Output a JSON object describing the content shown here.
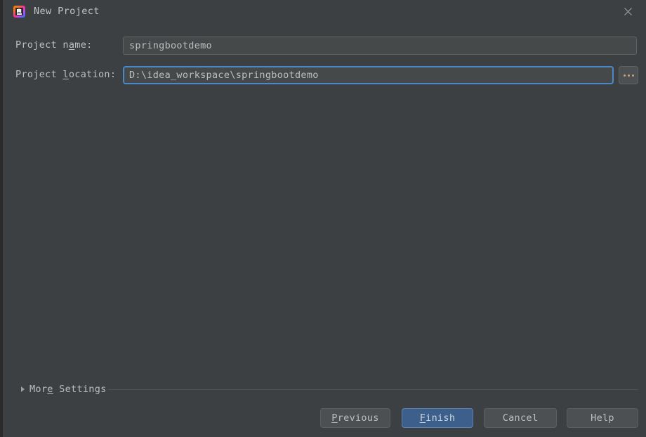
{
  "window": {
    "title": "New Project",
    "icon": "intellij-idea-logo",
    "close_icon": "close-icon"
  },
  "form": {
    "project_name": {
      "label_before": "Project n",
      "label_mnemonic": "a",
      "label_after": "me:",
      "value": "springbootdemo"
    },
    "project_location": {
      "label_before": "Project ",
      "label_mnemonic": "l",
      "label_after": "ocation:",
      "value": "D:\\idea_workspace\\springbootdemo",
      "browse_label": "..."
    }
  },
  "more_settings": {
    "label_before": "Mor",
    "label_mnemonic": "e",
    "label_after": " Settings",
    "expanded": false,
    "arrow_icon": "chevron-right-icon"
  },
  "buttons": {
    "previous": {
      "before": "",
      "mnemonic": "P",
      "after": "revious"
    },
    "finish": {
      "before": "",
      "mnemonic": "F",
      "after": "inish"
    },
    "cancel": {
      "before": "Cancel",
      "mnemonic": "",
      "after": ""
    },
    "help": {
      "before": "Help",
      "mnemonic": "",
      "after": ""
    }
  },
  "colors": {
    "background": "#3c4043",
    "field_background": "#45494a",
    "field_border": "#5e6364",
    "focus_border": "#4a88c7",
    "text": "#bcbfc1",
    "default_button": "#3c5f8c",
    "button": "#4c5052"
  }
}
